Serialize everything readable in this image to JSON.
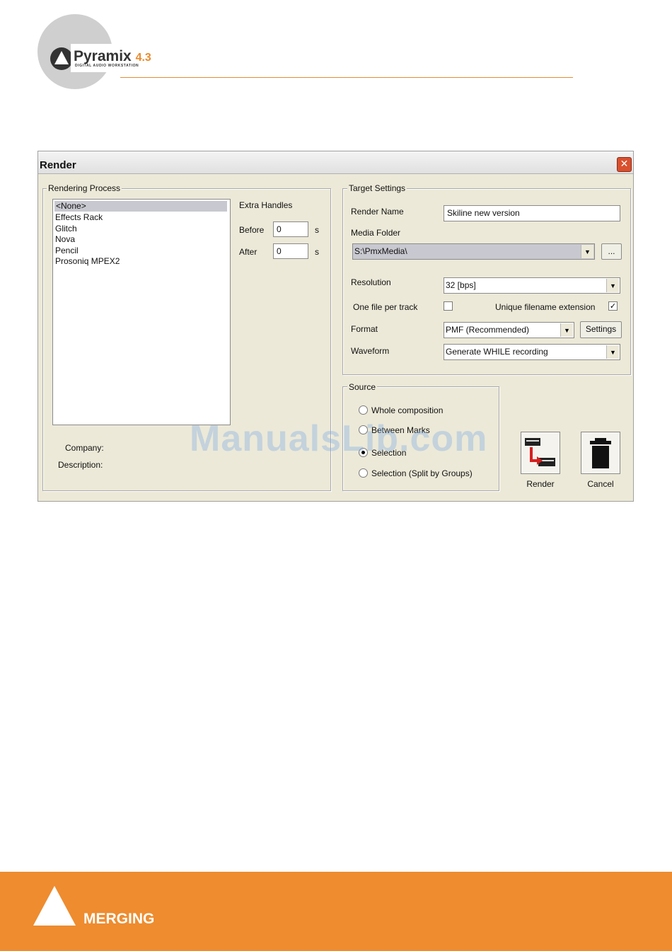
{
  "header": {
    "logo_name": "Pyramix",
    "logo_version": "4.3",
    "logo_subtitle": "DIGITAL AUDIO WORKSTATION"
  },
  "dialog": {
    "title": "Render",
    "close_symbol": "✕",
    "rendering_process": {
      "legend": "Rendering Process",
      "items": [
        "<None>",
        "Effects Rack",
        "Glitch",
        "Nova",
        "Pencil",
        "Prosoniq MPEX2"
      ],
      "selected_index": 0,
      "extra_handles_label": "Extra Handles",
      "before_label": "Before",
      "before_value": "0",
      "after_label": "After",
      "after_value": "0",
      "unit": "s",
      "company_label": "Company:",
      "description_label": "Description:"
    },
    "target_settings": {
      "legend": "Target Settings",
      "render_name_label": "Render Name",
      "render_name_value": "Skiline new version",
      "media_folder_label": "Media Folder",
      "media_folder_value": "S:\\PmxMedia\\",
      "browse_label": "...",
      "resolution_label": "Resolution",
      "resolution_value": "32 [bps]",
      "one_file_label": "One file per track",
      "one_file_checked": false,
      "unique_ext_label": "Unique filename extension",
      "unique_ext_checked": true,
      "format_label": "Format",
      "format_value": "PMF (Recommended)",
      "settings_label": "Settings",
      "waveform_label": "Waveform",
      "waveform_value": "Generate WHILE recording"
    },
    "source": {
      "legend": "Source",
      "options": [
        "Whole composition",
        "Between Marks",
        "Selection",
        "Selection (Split by Groups)"
      ],
      "selected_index": 2
    },
    "render_button_label": "Render",
    "cancel_button_label": "Cancel"
  },
  "watermark": "ManualsLib.com",
  "footer": {
    "brand": "MERGING"
  }
}
